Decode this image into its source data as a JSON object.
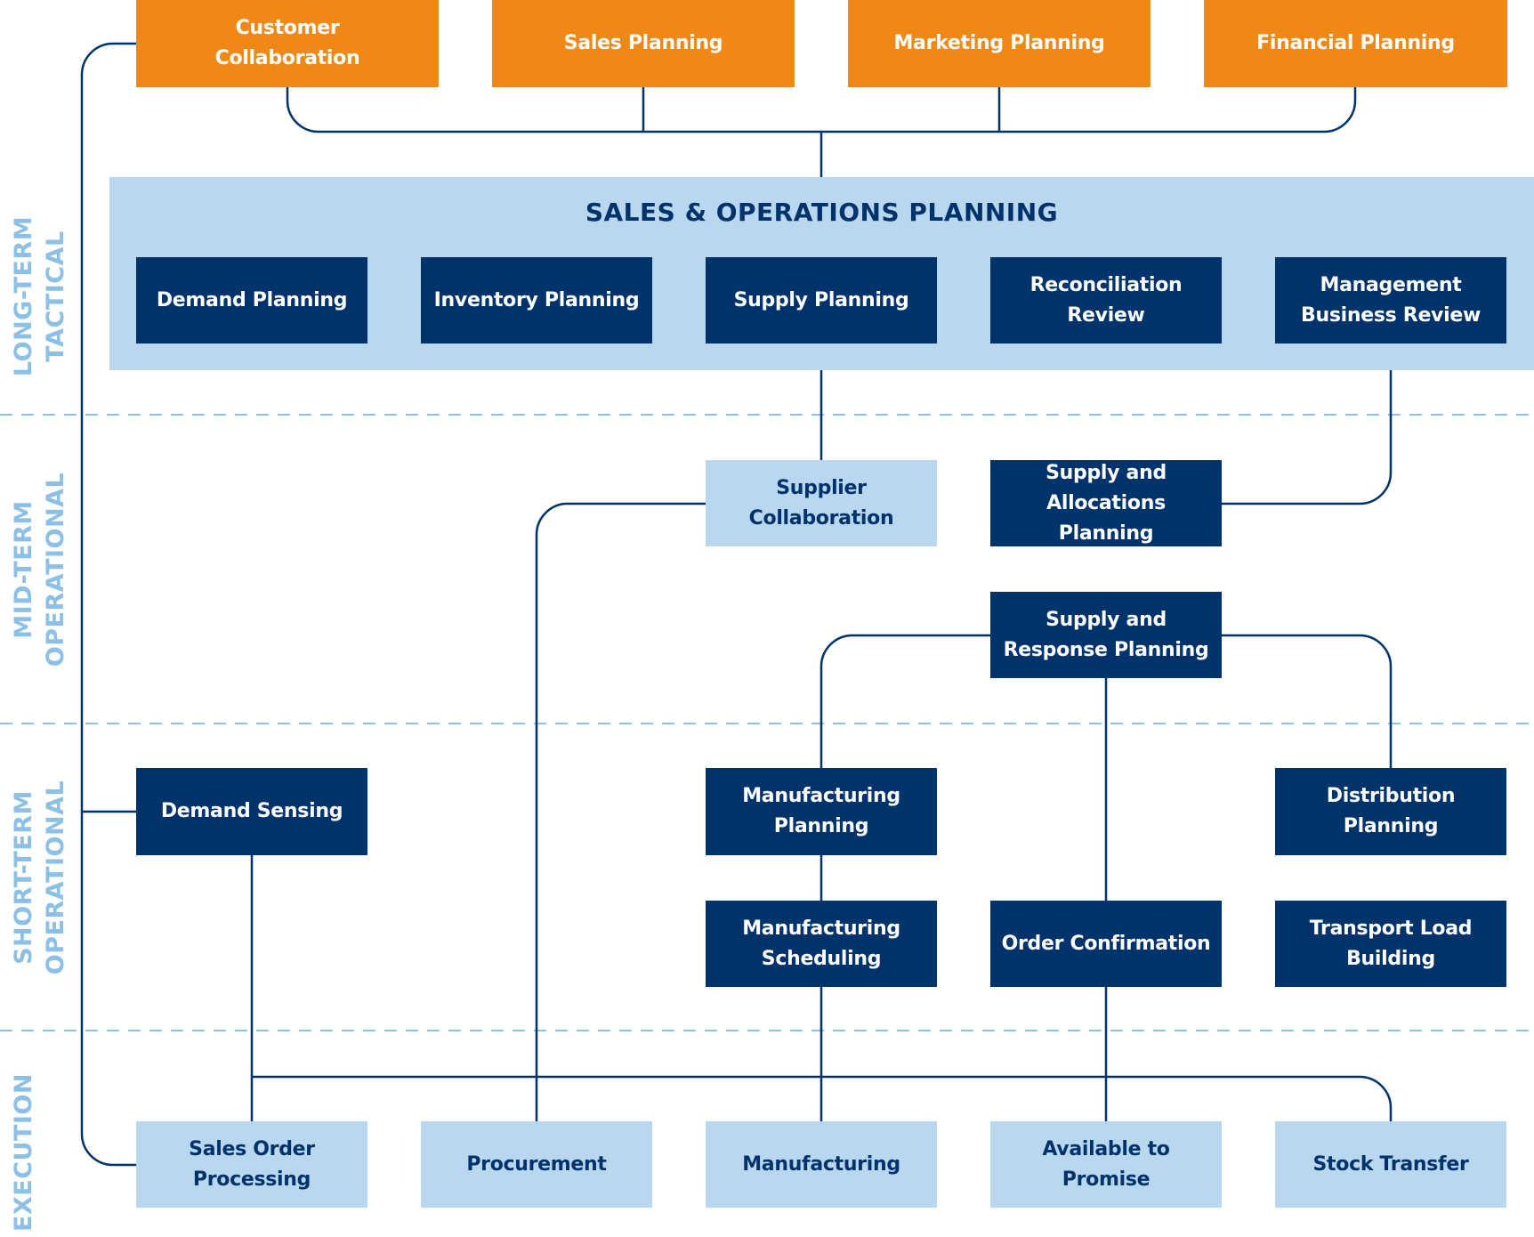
{
  "colors": {
    "orange": "#ef8817",
    "navy": "#00326c",
    "light_blue": "#b9d8f0",
    "tier_label": "#8dc0e6",
    "connector": "#00326c",
    "divider": "#8dc0e6"
  },
  "tiers": [
    {
      "line1": "LONG-TERM",
      "line2": "TACTICAL"
    },
    {
      "line1": "MID-TERM",
      "line2": "OPERATIONAL"
    },
    {
      "line1": "SHORT-TERM",
      "line2": "OPERATIONAL"
    },
    {
      "line1": "EXECUTION",
      "line2": ""
    }
  ],
  "inputs": [
    {
      "label": "Customer\nCollaboration"
    },
    {
      "label": "Sales Planning"
    },
    {
      "label": "Marketing Planning"
    },
    {
      "label": "Financial Planning"
    }
  ],
  "sop": {
    "title": "SALES & OPERATIONS PLANNING",
    "steps": [
      {
        "label": "Demand Planning"
      },
      {
        "label": "Inventory Planning"
      },
      {
        "label": "Supply Planning"
      },
      {
        "label": "Reconciliation\nReview"
      },
      {
        "label": "Management\nBusiness Review"
      }
    ]
  },
  "mid_term": {
    "supplier_collaboration": "Supplier\nCollaboration",
    "supply_allocations": "Supply and\nAllocations Planning",
    "supply_response": "Supply and\nResponse Planning"
  },
  "short_term": {
    "demand_sensing": "Demand Sensing",
    "manufacturing_planning": "Manufacturing\nPlanning",
    "distribution_planning": "Distribution\nPlanning",
    "manufacturing_scheduling": "Manufacturing\nScheduling",
    "order_confirmation": "Order Confirmation",
    "transport_load_building": "Transport Load\nBuilding"
  },
  "execution": [
    {
      "label": "Sales Order\nProcessing"
    },
    {
      "label": "Procurement"
    },
    {
      "label": "Manufacturing"
    },
    {
      "label": "Available to Promise"
    },
    {
      "label": "Stock Transfer"
    }
  ]
}
